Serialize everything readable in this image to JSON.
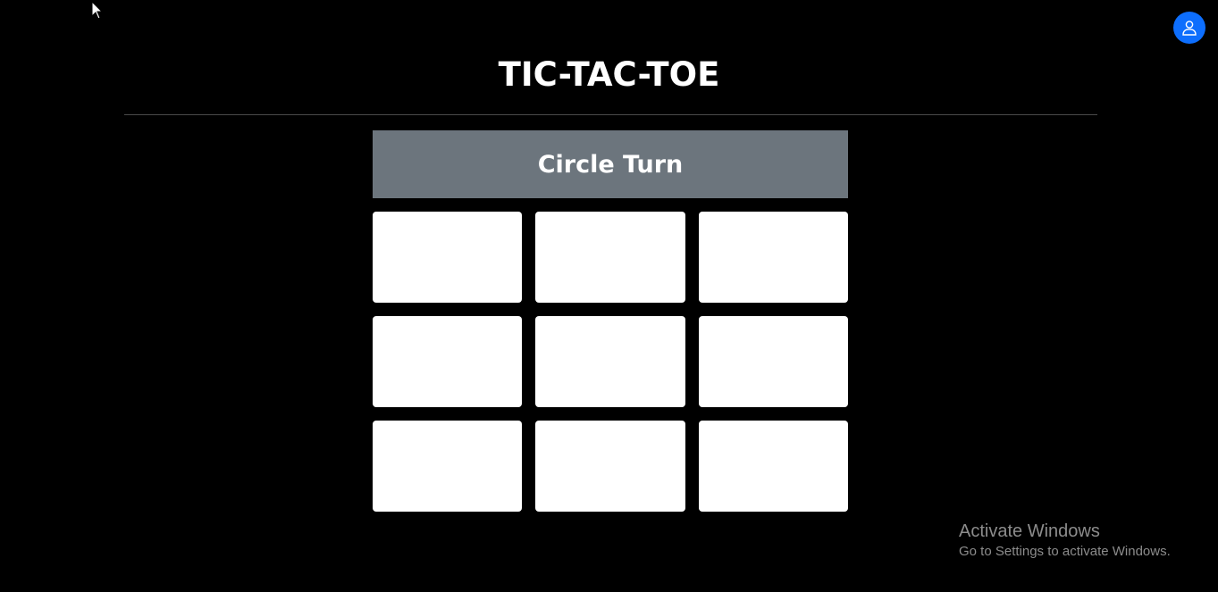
{
  "header": {
    "title": "TIC-TAC-TOE"
  },
  "user_button": {
    "icon": "user-icon",
    "color": "#0d6efd"
  },
  "status": {
    "turn_text": "Circle Turn",
    "banner_color": "#6c757d"
  },
  "board": {
    "rows": 3,
    "columns": 3,
    "cells": [
      "",
      "",
      "",
      "",
      "",
      "",
      "",
      "",
      ""
    ]
  },
  "watermark": {
    "title": "Activate Windows",
    "subtitle": "Go to Settings to activate Windows."
  }
}
